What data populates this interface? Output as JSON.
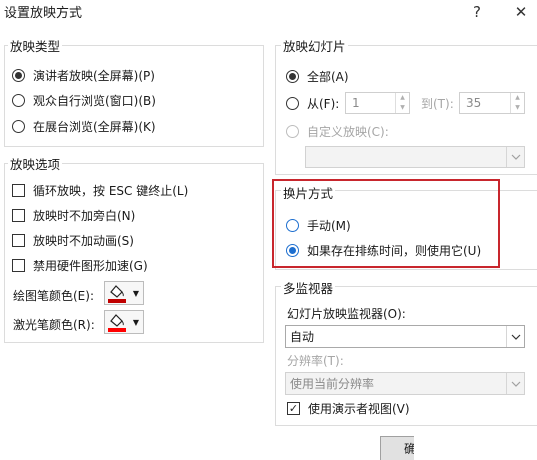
{
  "window": {
    "title": "设置放映方式",
    "help_label": "?",
    "close_label": "✕"
  },
  "show_type": {
    "legend": "放映类型",
    "options": [
      {
        "label": "演讲者放映(全屏幕)(P)",
        "checked": true
      },
      {
        "label": "观众自行浏览(窗口)(B)",
        "checked": false
      },
      {
        "label": "在展台浏览(全屏幕)(K)",
        "checked": false
      }
    ]
  },
  "show_options": {
    "legend": "放映选项",
    "checkboxes": [
      {
        "label": "循环放映，按 ESC 键终止(L)",
        "checked": false
      },
      {
        "label": "放映时不加旁白(N)",
        "checked": false
      },
      {
        "label": "放映时不加动画(S)",
        "checked": false
      },
      {
        "label": "禁用硬件图形加速(G)",
        "checked": false
      }
    ],
    "pen_color_label": "绘图笔颜色(E):",
    "laser_color_label": "激光笔颜色(R):",
    "pen_color": "#c00000",
    "laser_color": "#ff0000",
    "color_icon": "paint-bucket-icon"
  },
  "slides": {
    "legend": "放映幻灯片",
    "all_label": "全部(A)",
    "from_label": "从(F):",
    "from_value": "1",
    "to_label": "到(T):",
    "to_value": "35",
    "custom_label": "自定义放映(C):",
    "custom_value": ""
  },
  "advance": {
    "legend": "换片方式",
    "manual_label": "手动(M)",
    "timings_label": "如果存在排练时间，则使用它(U)",
    "highlight_color": "#c8262d"
  },
  "monitors": {
    "legend": "多监视器",
    "monitor_label": "幻灯片放映监视器(O):",
    "monitor_value": "自动",
    "resolution_label": "分辨率(T):",
    "resolution_value": "使用当前分辨率",
    "presenter_view_label": "使用演示者视图(V)",
    "presenter_view_checked": true
  },
  "footer": {
    "ok_label": "确"
  }
}
